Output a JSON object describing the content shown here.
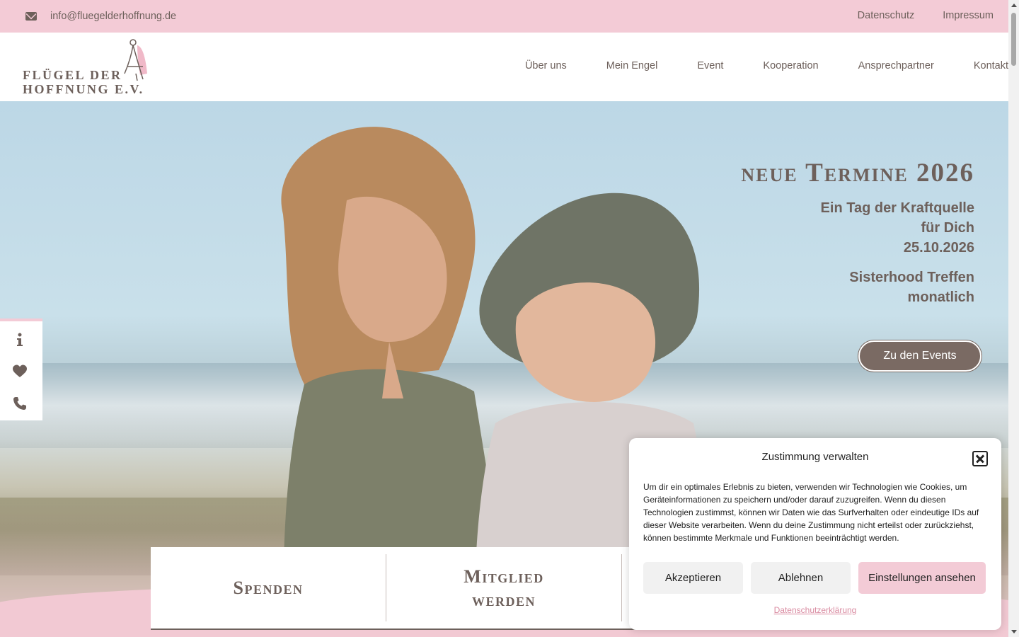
{
  "topbar": {
    "email": "info@fluegelderhoffnung.de",
    "links": [
      "Datenschutz",
      "Impressum"
    ]
  },
  "logo": {
    "line1": "FLÜGEL DER",
    "line2": "HOFFNUNG E.V."
  },
  "nav": {
    "items": [
      "Über uns",
      "Mein Engel",
      "Event",
      "Kooperation",
      "Ansprechpartner",
      "Kontakt"
    ]
  },
  "hero": {
    "title": "neue Termine 2026",
    "event1_line1": "Ein Tag der Kraftquelle",
    "event1_line2": "für Dich",
    "event1_date": "25.10.2026",
    "event2_line1": "Sisterhood Treffen",
    "event2_line2": "monatlich",
    "button": "Zu den Events"
  },
  "sidebar": {
    "icons": [
      "info-icon",
      "heart-icon",
      "phone-icon"
    ]
  },
  "cards": {
    "donate": "Spenden",
    "member_line1": "Mitglied",
    "member_line2": "werden"
  },
  "cookie": {
    "title": "Zustimmung verwalten",
    "body": "Um dir ein optimales Erlebnis zu bieten, verwenden wir Technologien wie Cookies, um Geräteinformationen zu speichern und/oder darauf zuzugreifen. Wenn du diesen Technologien zustimmst, können wir Daten wie das Surfverhalten oder eindeutige IDs auf dieser Website verarbeiten. Wenn du deine Zustimmung nicht erteilst oder zurückziehst, können bestimmte Merkmale und Funktionen beeinträchtigt werden.",
    "accept": "Akzeptieren",
    "deny": "Ablehnen",
    "settings": "Einstellungen ansehen",
    "privacy_link": "Datenschutzerklärung"
  },
  "colors": {
    "brand_pink": "#f3cbd6",
    "brand_brown": "#6d605b"
  }
}
